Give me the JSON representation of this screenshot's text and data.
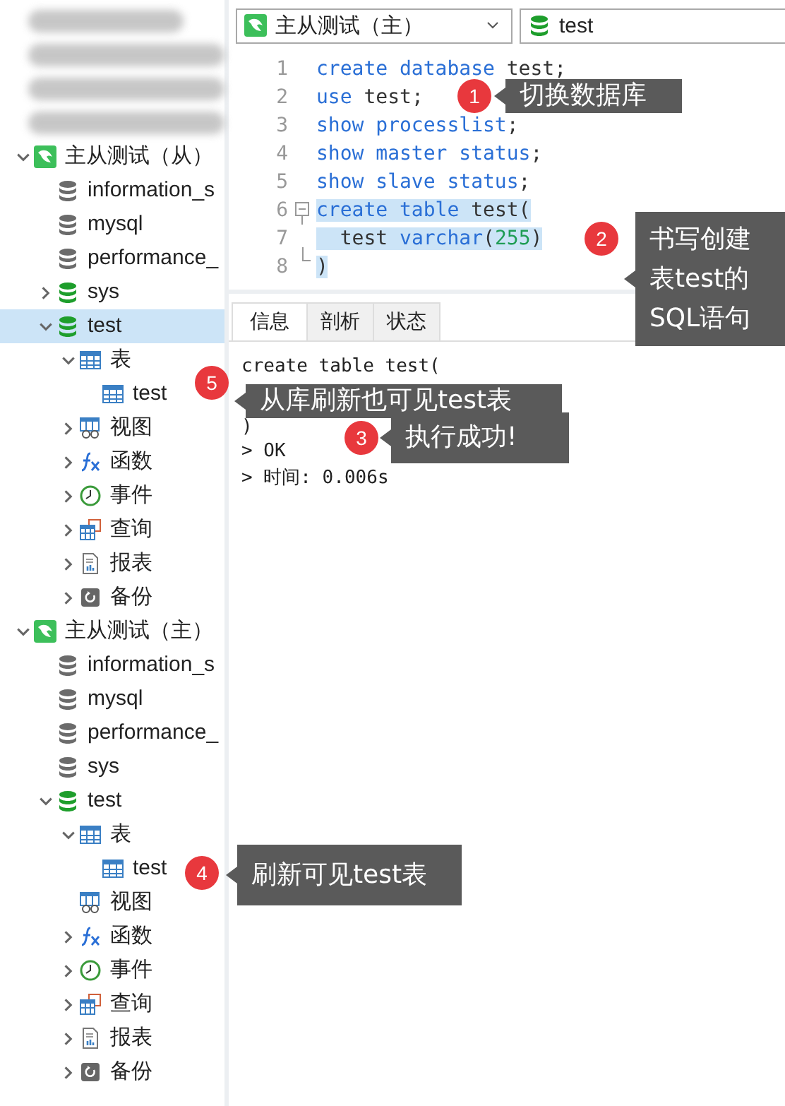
{
  "sidebar": {
    "blurred_rows": [
      {
        "kind": "blurred"
      },
      {
        "kind": "blurred"
      },
      {
        "kind": "blurred"
      },
      {
        "kind": "blurred"
      }
    ],
    "tree": [
      {
        "label": "主从测试（从）",
        "kind": "connection",
        "expanded": true,
        "selected": false,
        "children": [
          {
            "label": "information_s",
            "kind": "db",
            "selected": false
          },
          {
            "label": "mysql",
            "kind": "db",
            "selected": false
          },
          {
            "label": "performance_",
            "kind": "db",
            "selected": false
          },
          {
            "label": "sys",
            "kind": "db-open",
            "expanded": false,
            "selected": false
          },
          {
            "label": "test",
            "kind": "db-open",
            "expanded": true,
            "selected": true,
            "children": [
              {
                "label": "表",
                "kind": "tables",
                "expanded": true,
                "selected": false,
                "children": [
                  {
                    "label": "test",
                    "kind": "tables",
                    "selected": false
                  }
                ]
              },
              {
                "label": "视图",
                "kind": "view",
                "expanded": false,
                "selected": false
              },
              {
                "label": "函数",
                "kind": "function",
                "expanded": false,
                "selected": false
              },
              {
                "label": "事件",
                "kind": "event",
                "expanded": false,
                "selected": false
              },
              {
                "label": "查询",
                "kind": "query",
                "expanded": false,
                "selected": false
              },
              {
                "label": "报表",
                "kind": "report",
                "expanded": false,
                "selected": false
              },
              {
                "label": "备份",
                "kind": "backup",
                "expanded": false,
                "selected": false
              }
            ]
          }
        ]
      },
      {
        "label": "主从测试（主）",
        "kind": "connection",
        "expanded": true,
        "selected": false,
        "children": [
          {
            "label": "information_s",
            "kind": "db",
            "selected": false
          },
          {
            "label": "mysql",
            "kind": "db",
            "selected": false
          },
          {
            "label": "performance_",
            "kind": "db",
            "selected": false
          },
          {
            "label": "sys",
            "kind": "db",
            "selected": false
          },
          {
            "label": "test",
            "kind": "db-open",
            "expanded": true,
            "selected": false,
            "children": [
              {
                "label": "表",
                "kind": "tables",
                "expanded": true,
                "selected": false,
                "children": [
                  {
                    "label": "test",
                    "kind": "tables",
                    "selected": false
                  }
                ]
              },
              {
                "label": "视图",
                "kind": "view",
                "selected": false
              },
              {
                "label": "函数",
                "kind": "function",
                "expanded": false,
                "selected": false
              },
              {
                "label": "事件",
                "kind": "event",
                "expanded": false,
                "selected": false
              },
              {
                "label": "查询",
                "kind": "query",
                "expanded": false,
                "selected": false
              },
              {
                "label": "报表",
                "kind": "report",
                "expanded": false,
                "selected": false
              },
              {
                "label": "备份",
                "kind": "backup",
                "expanded": false,
                "selected": false
              }
            ]
          }
        ]
      }
    ]
  },
  "toolbar": {
    "connection_select": {
      "value": "主从测试（主）",
      "kind": "connection"
    },
    "database_select": {
      "value": "test",
      "kind": "db-open"
    }
  },
  "editor": {
    "lines": [
      {
        "number": "1",
        "selected": false,
        "tokens": [
          {
            "t": "create database",
            "color": "#2a6fd6"
          },
          {
            "t": " test;",
            "color": "#333333"
          }
        ]
      },
      {
        "number": "2",
        "selected": false,
        "tokens": [
          {
            "t": "use",
            "color": "#2a6fd6"
          },
          {
            "t": " test;",
            "color": "#333333"
          }
        ]
      },
      {
        "number": "3",
        "selected": false,
        "tokens": [
          {
            "t": "show processlist",
            "color": "#2a6fd6"
          },
          {
            "t": ";",
            "color": "#333333"
          }
        ]
      },
      {
        "number": "4",
        "selected": false,
        "tokens": [
          {
            "t": "show master status",
            "color": "#2a6fd6"
          },
          {
            "t": ";",
            "color": "#333333"
          }
        ]
      },
      {
        "number": "5",
        "selected": false,
        "tokens": [
          {
            "t": "show slave status",
            "color": "#2a6fd6"
          },
          {
            "t": ";",
            "color": "#333333"
          }
        ]
      },
      {
        "number": "6",
        "selected": true,
        "fold_start": true,
        "tokens": [
          {
            "t": "create table",
            "color": "#2a6fd6"
          },
          {
            "t": " test(",
            "color": "#333333"
          }
        ]
      },
      {
        "number": "7",
        "selected": true,
        "fold_end": true,
        "tokens": [
          {
            "t": "  test ",
            "color": "#333333"
          },
          {
            "t": "varchar",
            "color": "#2a6fd6"
          },
          {
            "t": "(",
            "color": "#333333"
          },
          {
            "t": "255",
            "color": "#1f9d55"
          },
          {
            "t": ")",
            "color": "#333333"
          }
        ]
      },
      {
        "number": "8",
        "selected": true,
        "tokens": [
          {
            "t": ")",
            "color": "#333333"
          }
        ]
      }
    ]
  },
  "result_tabs": [
    {
      "label": "信息",
      "selected": true
    },
    {
      "label": "剖析",
      "selected": false
    },
    {
      "label": "状态",
      "selected": false
    }
  ],
  "output": [
    "create table test(",
    ")",
    "> OK",
    "> 时间: 0.006s"
  ],
  "callouts": [
    {
      "number": "1",
      "text": "切换数据库"
    },
    {
      "number": "2",
      "text": "书写创建表test的SQL语句"
    },
    {
      "number": "5",
      "text": "从库刷新也可见test表"
    },
    {
      "number": "3",
      "text": "执行成功!"
    },
    {
      "number": "4",
      "text": "刷新可见test表"
    }
  ]
}
